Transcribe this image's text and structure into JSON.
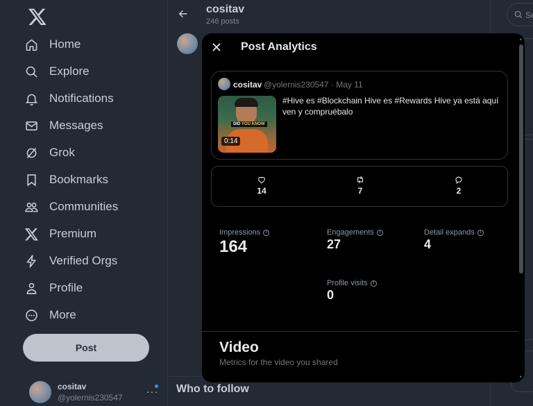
{
  "nav": {
    "items": [
      {
        "label": "Home",
        "icon": "home-icon"
      },
      {
        "label": "Explore",
        "icon": "search-icon"
      },
      {
        "label": "Notifications",
        "icon": "bell-icon"
      },
      {
        "label": "Messages",
        "icon": "envelope-icon"
      },
      {
        "label": "Grok",
        "icon": "grok-icon"
      },
      {
        "label": "Bookmarks",
        "icon": "bookmark-icon"
      },
      {
        "label": "Communities",
        "icon": "people-icon"
      },
      {
        "label": "Premium",
        "icon": "x-logo-icon"
      },
      {
        "label": "Verified Orgs",
        "icon": "lightning-icon"
      },
      {
        "label": "Profile",
        "icon": "person-icon"
      },
      {
        "label": "More",
        "icon": "more-circle-icon"
      }
    ],
    "post_label": "Post"
  },
  "account": {
    "name": "cositav",
    "handle": "@yolernis230547"
  },
  "column": {
    "title": "cositav",
    "posts_count": "246 posts",
    "who_to_follow": "Who to follow"
  },
  "right": {
    "search_placeholder": "Se"
  },
  "modal": {
    "title": "Post Analytics",
    "tweet": {
      "name": "cositav",
      "handle_date": "@yolernis230547 · May 11",
      "text": "#Hive es #Blockchain Hive es #Rewards Hive ya está aquí ven y compruébalo",
      "video_duration": "0:14",
      "thumb_caption_1": "DID",
      "thumb_caption_2": "YOU KNOW"
    },
    "engagement": {
      "likes": "14",
      "reposts": "7",
      "replies": "2"
    },
    "metrics": {
      "impressions_label": "Impressions",
      "impressions_value": "164",
      "engagements_label": "Engagements",
      "engagements_value": "27",
      "detail_label": "Detail expands",
      "detail_value": "4",
      "profile_label": "Profile visits",
      "profile_value": "0"
    },
    "video": {
      "title": "Video",
      "subtitle": "Metrics for the video you shared"
    }
  },
  "colors": {
    "background": "#232a33",
    "modal": "#000000",
    "accent": "#1d9bf0"
  }
}
